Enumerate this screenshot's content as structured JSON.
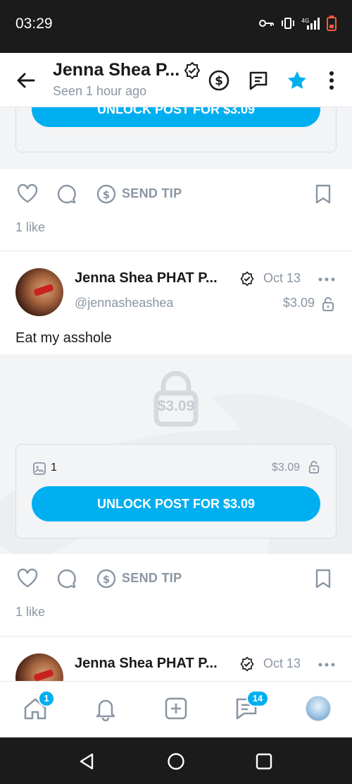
{
  "status_bar": {
    "time": "03:29"
  },
  "header": {
    "title": "Jenna Shea P...",
    "subtitle": "Seen  1 hour ago"
  },
  "top_post": {
    "unlock_label": "UNLOCK POST FOR $3.09",
    "send_tip_label": "SEND TIP",
    "likes": "1 like"
  },
  "post": {
    "author": "Jenna Shea PHAT P...",
    "handle": "@jennasheashea",
    "date": "Oct 13",
    "price": "$3.09",
    "text": "Eat my asshole",
    "locked_price": "$3.09",
    "media_count": "1",
    "card_price": "$3.09",
    "unlock_label": "UNLOCK POST FOR $3.09",
    "send_tip_label": "SEND TIP",
    "likes": "1 like"
  },
  "next_post": {
    "author": "Jenna Shea PHAT P...",
    "date": "Oct 13"
  },
  "bottom_nav": {
    "home_badge": "1",
    "messages_badge": "14"
  },
  "colors": {
    "accent": "#00aff0",
    "muted": "#8a96a3"
  }
}
